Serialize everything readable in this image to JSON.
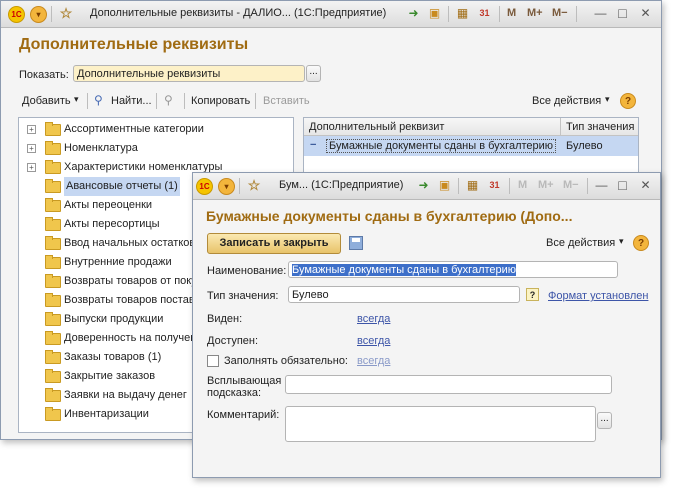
{
  "main_window": {
    "title": "Дополнительные реквизиты - ДАЛИО...  (1С:Предприятие)",
    "header": "Дополнительные реквизиты",
    "show_label": "Показать:",
    "show_value": "Дополнительные реквизиты",
    "toolbar": {
      "add": "Добавить",
      "find": "Найти...",
      "copy": "Копировать",
      "paste": "Вставить",
      "all_actions": "Все действия"
    },
    "tree": [
      {
        "label": "Ассортиментные категории",
        "expandable": true
      },
      {
        "label": "Номенклатура",
        "expandable": true
      },
      {
        "label": "Характеристики номенклатуры",
        "expandable": true
      },
      {
        "label": "Авансовые отчеты (1)",
        "selected": true
      },
      {
        "label": "Акты переоценки"
      },
      {
        "label": "Акты пересортицы"
      },
      {
        "label": "Ввод начальных остатков"
      },
      {
        "label": "Внутренние продажи"
      },
      {
        "label": "Возвраты товаров от покупателей"
      },
      {
        "label": "Возвраты товаров поставщикам"
      },
      {
        "label": "Выпуски продукции"
      },
      {
        "label": "Доверенность на получение"
      },
      {
        "label": "Заказы товаров (1)"
      },
      {
        "label": "Закрытие заказов"
      },
      {
        "label": "Заявки на выдачу денег"
      },
      {
        "label": "Инвентаризации"
      }
    ],
    "grid": {
      "col_attribute": "Дополнительный реквизит",
      "col_type": "Тип значения",
      "rows": [
        {
          "attribute": "Бумажные документы сданы в бухгалтерию",
          "type": "Булево"
        }
      ]
    }
  },
  "dialog": {
    "title": "Бум...  (1С:Предприятие)",
    "header": "Бумажные документы сданы в бухгалтерию (Допо...",
    "save_close": "Записать и закрыть",
    "all_actions": "Все действия",
    "name_label": "Наименование:",
    "name_value": "Бумажные документы сданы в бухгалтерию",
    "type_label": "Тип значения:",
    "type_value": "Булево",
    "format_link": "Формат установлен",
    "visible_label": "Виден:",
    "visible_value": "всегда",
    "available_label": "Доступен:",
    "available_value": "всегда",
    "required_label": "Заполнять обязательно:",
    "required_value": "всегда",
    "tooltip_label_1": "Всплывающая",
    "tooltip_label_2": "подсказка:",
    "comment_label": "Комментарий:"
  },
  "icons": {
    "logo": "1c-logo-icon",
    "menu": "menu-circle-icon",
    "favorite": "star-icon"
  },
  "titlebar_glyphs": {
    "minimize": "—",
    "maximize": "□",
    "close": "✕",
    "m": "M",
    "mplus": "M+",
    "mminus": "M−",
    "dots": "...",
    "help": "?",
    "plus": "+",
    "minus": "−",
    "dropdown": "▾",
    "star": "☆",
    "logo": "1С"
  }
}
